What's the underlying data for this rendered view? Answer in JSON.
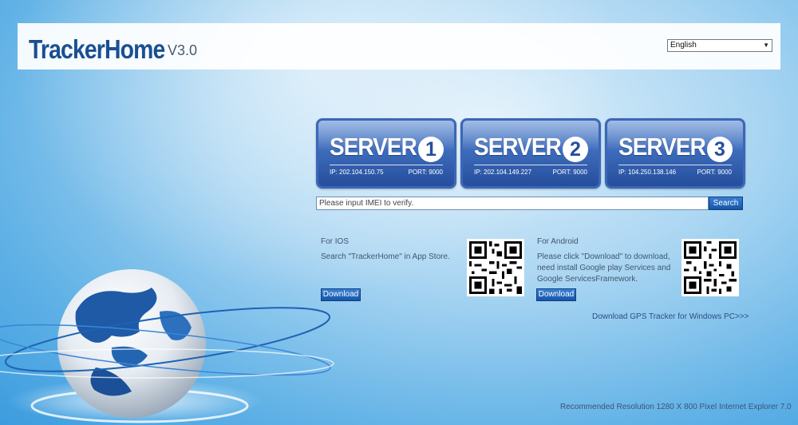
{
  "header": {
    "logo_main": "TrackerHome",
    "logo_version": "V3.0",
    "language_selected": "English"
  },
  "servers": [
    {
      "title": "SERVER",
      "number": "1",
      "ip": "IP: 202.104.150.75",
      "port": "PORT: 9000"
    },
    {
      "title": "SERVER",
      "number": "2",
      "ip": "IP: 202.104.149.227",
      "port": "PORT: 9000"
    },
    {
      "title": "SERVER",
      "number": "3",
      "ip": "IP: 104.250.138.146",
      "port": "PORT: 9000"
    }
  ],
  "imei": {
    "placeholder": "Please input IMEI to verify.",
    "search_label": "Search"
  },
  "ios": {
    "heading": "For IOS",
    "text": "Search \"TrackerHome\" in App Store.",
    "download_label": "Download"
  },
  "android": {
    "heading": "For Android",
    "text_line1": "Please click \"Download\" to download,",
    "text_line2": "need install Google play Services and",
    "text_line3": "Google ServicesFramework.",
    "download_label": "Download"
  },
  "pc_link": "Download GPS Tracker for Windows PC>>>",
  "footer": "Recommended Resolution 1280 X 800 Pixel Internet Explorer 7.0",
  "colors": {
    "brand": "#1a4f92",
    "server_blue": "#3e6cbc",
    "button_blue": "#1456a8"
  }
}
